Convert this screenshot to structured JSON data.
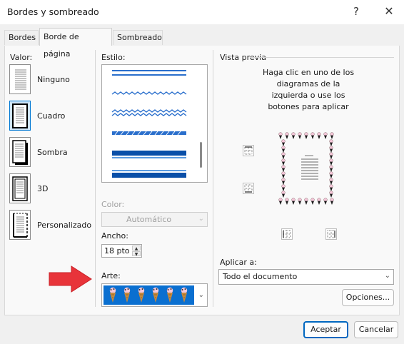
{
  "window": {
    "title": "Bordes y sombreado",
    "help_glyph": "?",
    "close_glyph": "✕"
  },
  "tabs": [
    {
      "label": "Bordes",
      "active": false
    },
    {
      "label": "Borde de página",
      "active": true
    },
    {
      "label": "Sombreado",
      "active": false
    }
  ],
  "setting": {
    "label": "Valor:",
    "options": [
      {
        "label": "Ninguno",
        "selected": false
      },
      {
        "label": "Cuadro",
        "selected": true
      },
      {
        "label": "Sombra",
        "selected": false
      },
      {
        "label": "3D",
        "selected": false
      },
      {
        "label": "Personalizado",
        "selected": false
      }
    ]
  },
  "style": {
    "label": "Estilo:",
    "line_styles": [
      "double-line",
      "wave",
      "double-wave",
      "striped",
      "thick-thin",
      "thin-thick"
    ]
  },
  "color": {
    "label": "Color:",
    "value": "Automático",
    "disabled": true
  },
  "width": {
    "label": "Ancho:",
    "value": "18 pto"
  },
  "art": {
    "label": "Arte:",
    "pattern": "ice-cream-cones",
    "background_color": "#0a6fd0"
  },
  "preview": {
    "label": "Vista previa",
    "instructions": [
      "Haga clic en uno de los",
      "diagramas de la",
      "izquierda o use los",
      "botones para aplicar"
    ]
  },
  "apply_to": {
    "label": "Aplicar a:",
    "value": "Todo el documento"
  },
  "buttons": {
    "options": "Opciones...",
    "ok": "Aceptar",
    "cancel": "Cancelar"
  },
  "colors": {
    "accent": "#0078d4",
    "annotation_arrow": "#e8343a"
  }
}
